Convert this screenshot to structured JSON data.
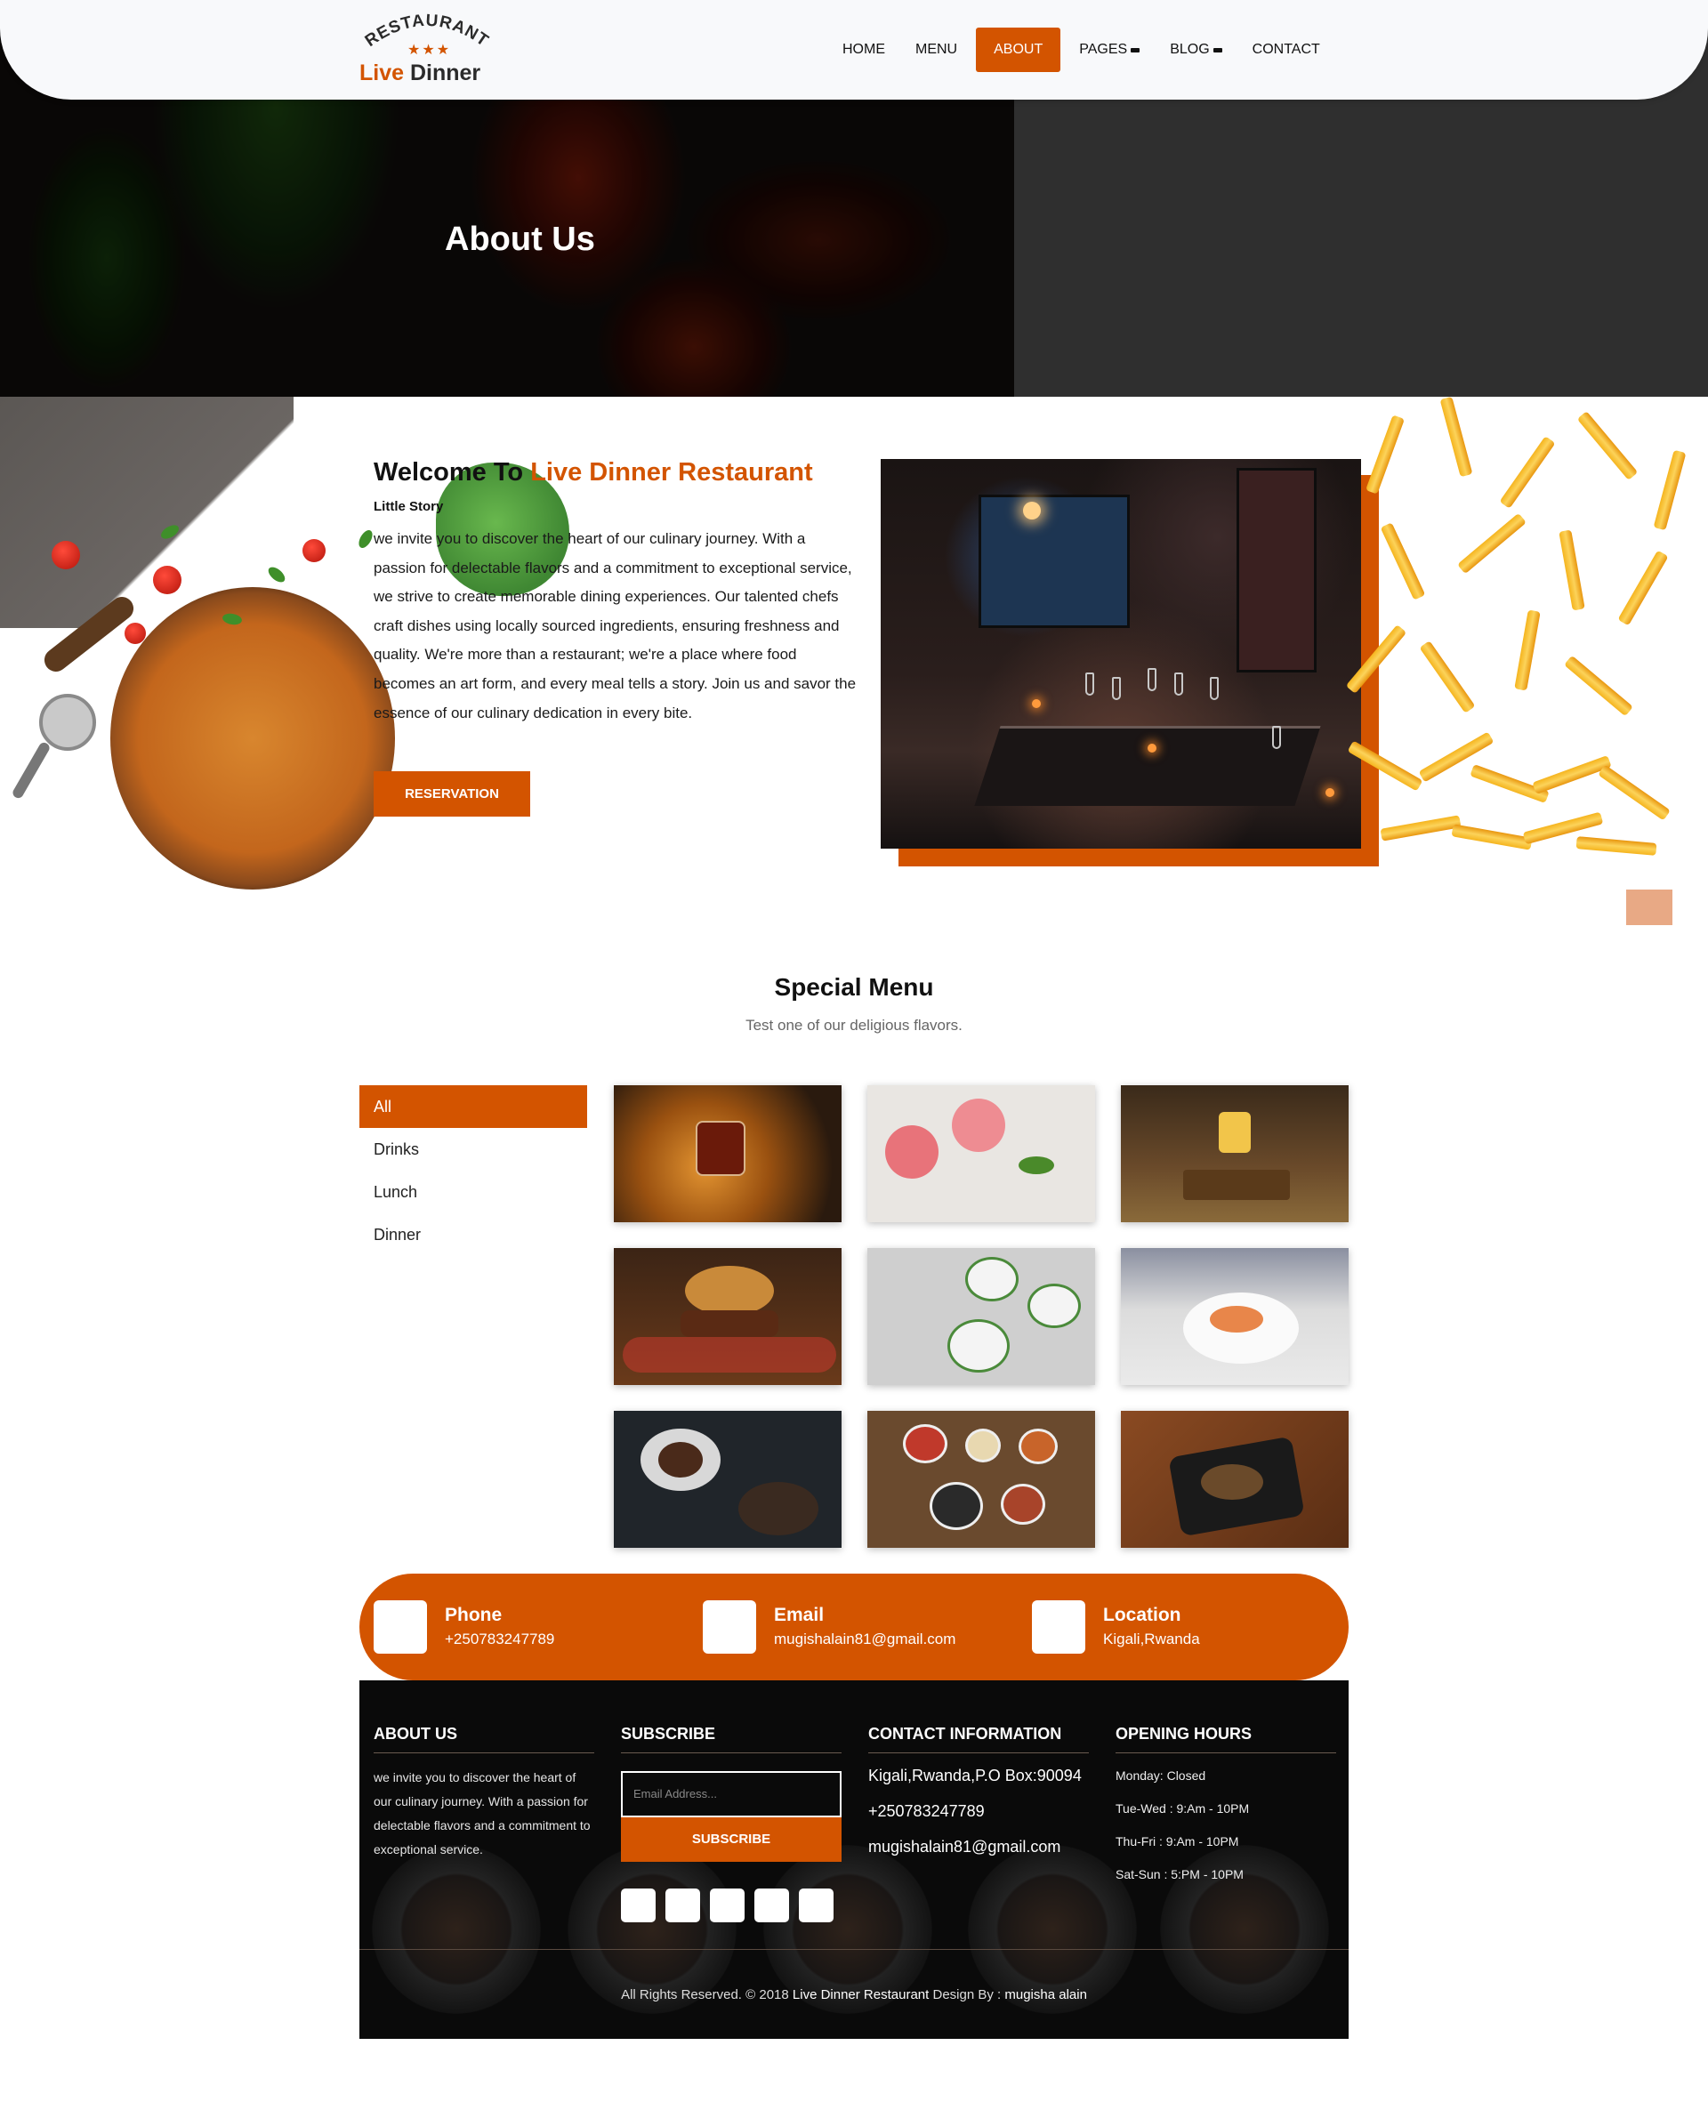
{
  "brand": {
    "arc_text": "RESTAURANT",
    "stars": "★★★",
    "name_accent": "Live",
    "name_rest": " Dinner"
  },
  "nav": {
    "items": [
      {
        "label": "HOME"
      },
      {
        "label": "MENU"
      },
      {
        "label": "ABOUT",
        "active": true
      },
      {
        "label": "PAGES"
      },
      {
        "label": "BLOG"
      },
      {
        "label": "CONTACT"
      }
    ]
  },
  "hero": {
    "title": "About Us"
  },
  "welcome": {
    "title_prefix": "Welcome To ",
    "title_accent": "Live Dinner Restaurant",
    "subtitle": "Little Story",
    "body": "we invite you to discover the heart of our culinary journey. With a passion for delectable flavors and a commitment to exceptional service, we strive to create memorable dining experiences. Our talented chefs craft dishes using locally sourced ingredients, ensuring freshness and quality. We're more than a restaurant; we're a place where food becomes an art form, and every meal tells a story. Join us and savor the essence of our culinary dedication in every bite.",
    "button": "RESERVATION"
  },
  "special": {
    "title": "Special Menu",
    "subtitle": "Test one of our deligious flavors.",
    "categories": [
      "All",
      "Drinks",
      "Lunch",
      "Dinner"
    ],
    "active_category": "All",
    "thumbnails": [
      {
        "name": "drink-whiskey-photo"
      },
      {
        "name": "drink-pink-cocktail-photo"
      },
      {
        "name": "drink-beer-photo"
      },
      {
        "name": "lunch-burger-photo"
      },
      {
        "name": "lunch-salad-photo"
      },
      {
        "name": "lunch-salmon-photo"
      },
      {
        "name": "dinner-table-photo"
      },
      {
        "name": "dinner-bowls-photo"
      },
      {
        "name": "dinner-plate-photo"
      }
    ]
  },
  "contact": {
    "phone_label": "Phone",
    "phone_value": "+250783247789",
    "email_label": "Email",
    "email_value": "mugishalain81@gmail.com",
    "location_label": "Location",
    "location_value": "Kigali,Rwanda"
  },
  "footer": {
    "about_title": "ABOUT US",
    "about_text": "we invite you to discover the heart of our culinary journey. With a passion for delectable flavors and a commitment to exceptional service.",
    "subscribe_title": "SUBSCRIBE",
    "subscribe_placeholder": "Email Address...",
    "subscribe_button": "SUBSCRIBE",
    "contact_title": "CONTACT INFORMATION",
    "contact_address": "Kigali,Rwanda,P.O Box:90094",
    "contact_phone": "+250783247789",
    "contact_email": "mugishalain81@gmail.com",
    "hours_title": "OPENING HOURS",
    "hours": [
      "Monday: Closed",
      "Tue-Wed : 9:Am - 10PM",
      "Thu-Fri : 9:Am - 10PM",
      "Sat-Sun : 5:PM - 10PM"
    ],
    "copyright_prefix": "All Rights Reserved. © 2018 ",
    "copyright_brand": "Live Dinner Restaurant",
    "copyright_mid": " Design By : ",
    "copyright_author": "mugisha alain"
  },
  "colors": {
    "accent": "#d35400",
    "dark": "#0a0a0a",
    "hero_right": "#2f2f2f"
  }
}
